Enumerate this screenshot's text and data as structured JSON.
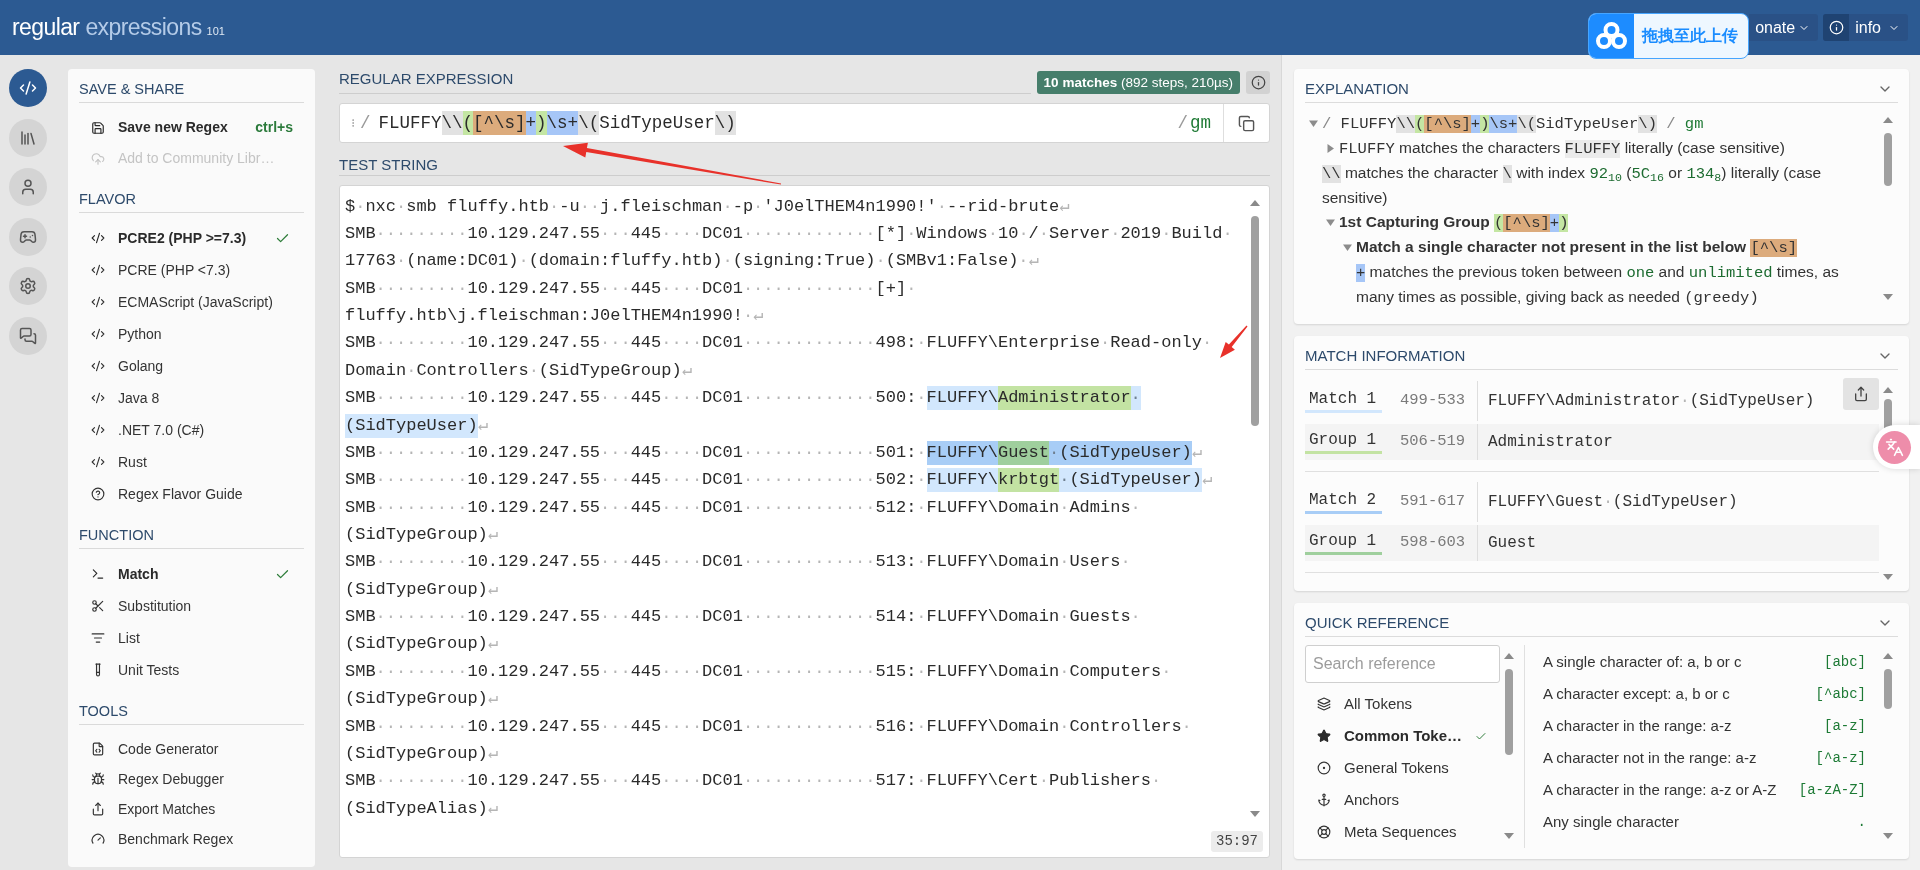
{
  "topbar": {
    "logo": {
      "primary": "regular",
      "secondary": "expressions",
      "version": "101"
    },
    "upload_widget": {
      "label": "拖拽至此上传"
    },
    "menus": [
      {
        "label": "onate"
      },
      {
        "label": "info"
      }
    ]
  },
  "rail": [
    {
      "selected": true
    },
    {
      "selected": false
    },
    {
      "selected": false
    },
    {
      "selected": false
    },
    {
      "selected": false
    },
    {
      "selected": false
    }
  ],
  "sidebar": {
    "sections": [
      {
        "kind": "actions",
        "title": "SAVE & SHARE",
        "items": [
          {
            "label": "Save new Regex",
            "shortcut": "ctrl+s",
            "disabled": false
          },
          {
            "label": "Add to Community Libr…",
            "disabled": true
          }
        ]
      },
      {
        "kind": "choices",
        "title": "FLAVOR",
        "items": [
          {
            "label": "PCRE2 (PHP >=7.3)",
            "selected": true
          },
          {
            "label": "PCRE (PHP <7.3)",
            "selected": false
          },
          {
            "label": "ECMAScript (JavaScript)",
            "selected": false
          },
          {
            "label": "Python",
            "selected": false
          },
          {
            "label": "Golang",
            "selected": false
          },
          {
            "label": "Java 8",
            "selected": false
          },
          {
            "label": ".NET 7.0 (C#)",
            "selected": false
          },
          {
            "label": "Rust",
            "selected": false
          },
          {
            "label": "Regex Flavor Guide",
            "selected": false
          }
        ]
      },
      {
        "kind": "choices",
        "title": "FUNCTION",
        "items": [
          {
            "label": "Match",
            "selected": true
          },
          {
            "label": "Substitution",
            "selected": false
          },
          {
            "label": "List",
            "selected": false
          },
          {
            "label": "Unit Tests",
            "selected": false
          }
        ]
      },
      {
        "kind": "links",
        "title": "TOOLS",
        "items": [
          {
            "label": "Code Generator"
          },
          {
            "label": "Regex Debugger"
          },
          {
            "label": "Export Matches"
          },
          {
            "label": "Benchmark Regex"
          }
        ]
      }
    ]
  },
  "regex": {
    "heading": "REGULAR EXPRESSION",
    "status": "**10 matches** (892 steps, 210µs)",
    "open_delimiter": "/",
    "tokens": [
      {
        "kind": "literal",
        "text": "FLUFFY"
      },
      {
        "kind": "escape",
        "text": "\\\\"
      },
      {
        "kind": "group",
        "text": "("
      },
      {
        "kind": "class",
        "text": "[^\\s]"
      },
      {
        "kind": "quantifier",
        "text": "+"
      },
      {
        "kind": "group",
        "text": ")"
      },
      {
        "kind": "meta",
        "text": "\\s+"
      },
      {
        "kind": "escape",
        "text": "\\("
      },
      {
        "kind": "literal",
        "text": "SidTypeUser"
      },
      {
        "kind": "escape",
        "text": "\\)"
      }
    ],
    "close_delimiter": "/",
    "flags": "gm"
  },
  "test_string": {
    "heading": "TEST STRING",
    "lines": [
      {
        "segments": [
          {
            "kind": "text",
            "text": "$·nxc·smb fluffy.htb·-u··j.fleischman·-p·'J0elTHEM4n1990!'·--rid-brute↵"
          }
        ]
      },
      {
        "segments": [
          {
            "kind": "text",
            "text": "SMB·········10.129.247.55···445····DC01·············[*]·Windows·10·/·Server·2019·Build·"
          }
        ]
      },
      {
        "segments": [
          {
            "kind": "text",
            "text": "17763·(name:DC01)·(domain:fluffy.htb)·(signing:True)·(SMBv1:False)·↵"
          }
        ]
      },
      {
        "segments": [
          {
            "kind": "text",
            "text": "SMB·········10.129.247.55···445····DC01·············[+]·"
          }
        ]
      },
      {
        "segments": [
          {
            "kind": "text",
            "text": "fluffy.htb\\j.fleischman:J0elTHEM4n1990!·↵"
          }
        ]
      },
      {
        "segments": [
          {
            "kind": "text",
            "text": "SMB·········10.129.247.55···445····DC01·············498:·FLUFFY\\Enterprise·Read-only·"
          }
        ]
      },
      {
        "segments": [
          {
            "kind": "text",
            "text": "Domain·Controllers·(SidTypeGroup)↵"
          }
        ]
      },
      {
        "segments": [
          {
            "kind": "text",
            "text": "SMB·········10.129.247.55···445····DC01·············500:·"
          },
          {
            "kind": "match",
            "text": "FLUFFY\\",
            "color": "#d2e7fd"
          },
          {
            "kind": "group",
            "text": "Administrator",
            "color": "#c3e3a3"
          },
          {
            "kind": "match",
            "text": "·",
            "color": "#d2e7fd"
          }
        ]
      },
      {
        "segments": [
          {
            "kind": "match",
            "text": "(SidTypeUser)",
            "color": "#d2e7fd"
          },
          {
            "kind": "text",
            "text": "↵"
          }
        ]
      },
      {
        "segments": [
          {
            "kind": "text",
            "text": "SMB·········10.129.247.55···445····DC01·············501:·"
          },
          {
            "kind": "match",
            "text": "FLUFFY\\",
            "color": "#a8cdf6"
          },
          {
            "kind": "group",
            "text": "Guest",
            "color": "#9fcf9d"
          },
          {
            "kind": "match",
            "text": "·(SidTypeUser)",
            "color": "#a8cdf6"
          },
          {
            "kind": "text",
            "text": "↵"
          }
        ]
      },
      {
        "segments": [
          {
            "kind": "text",
            "text": "SMB·········10.129.247.55···445····DC01·············502:·"
          },
          {
            "kind": "match",
            "text": "FLUFFY\\",
            "color": "#d2e7fd"
          },
          {
            "kind": "group",
            "text": "krbtgt",
            "color": "#c3e3a3"
          },
          {
            "kind": "match",
            "text": "·(SidTypeUser)",
            "color": "#d2e7fd"
          },
          {
            "kind": "text",
            "text": "↵"
          }
        ]
      },
      {
        "segments": [
          {
            "kind": "text",
            "text": "SMB·········10.129.247.55···445····DC01·············512:·FLUFFY\\Domain·Admins·"
          }
        ]
      },
      {
        "segments": [
          {
            "kind": "text",
            "text": "(SidTypeGroup)↵"
          }
        ]
      },
      {
        "segments": [
          {
            "kind": "text",
            "text": "SMB·········10.129.247.55···445····DC01·············513:·FLUFFY\\Domain·Users·"
          }
        ]
      },
      {
        "segments": [
          {
            "kind": "text",
            "text": "(SidTypeGroup)↵"
          }
        ]
      },
      {
        "segments": [
          {
            "kind": "text",
            "text": "SMB·········10.129.247.55···445····DC01·············514:·FLUFFY\\Domain·Guests·"
          }
        ]
      },
      {
        "segments": [
          {
            "kind": "text",
            "text": "(SidTypeGroup)↵"
          }
        ]
      },
      {
        "segments": [
          {
            "kind": "text",
            "text": "SMB·········10.129.247.55···445····DC01·············515:·FLUFFY\\Domain·Computers·"
          }
        ]
      },
      {
        "segments": [
          {
            "kind": "text",
            "text": "(SidTypeGroup)↵"
          }
        ]
      },
      {
        "segments": [
          {
            "kind": "text",
            "text": "SMB·········10.129.247.55···445····DC01·············516:·FLUFFY\\Domain·Controllers·"
          }
        ]
      },
      {
        "segments": [
          {
            "kind": "text",
            "text": "(SidTypeGroup)↵"
          }
        ]
      },
      {
        "segments": [
          {
            "kind": "text",
            "text": "SMB·········10.129.247.55···445····DC01·············517:·FLUFFY\\Cert·Publishers·"
          }
        ]
      },
      {
        "segments": [
          {
            "kind": "text",
            "text": "(SidTypeAlias)↵"
          }
        ]
      }
    ],
    "cursor": "35:97"
  },
  "explanation": {
    "title": "EXPLANATION",
    "tree": [
      {
        "kind": "node",
        "expanded": true,
        "parts": [
          {
            "kind": "delim",
            "text": "/ "
          },
          {
            "kind": "literal",
            "text": "FLUFFY"
          },
          {
            "kind": "escape",
            "text": "\\\\"
          },
          {
            "kind": "group",
            "text": "("
          },
          {
            "kind": "class",
            "text": "[^\\s]"
          },
          {
            "kind": "quantifier",
            "text": "+"
          },
          {
            "kind": "group",
            "text": ")"
          },
          {
            "kind": "meta",
            "text": "\\s+"
          },
          {
            "kind": "escape",
            "text": "\\("
          },
          {
            "kind": "literal",
            "text": "SidTypeUser"
          },
          {
            "kind": "escape",
            "text": "\\)"
          },
          {
            "kind": "delim",
            "text": " / "
          },
          {
            "kind": "flags",
            "text": "gm"
          }
        ],
        "children": [
          {
            "kind": "node",
            "expanded": false,
            "parts": [
              {
                "kind": "literal",
                "text": "FLUFFY"
              },
              {
                "kind": "text",
                "text": " matches the characters "
              },
              {
                "kind": "boxed",
                "text": "FLUFFY"
              },
              {
                "kind": "text",
                "text": " literally (case sensitive)"
              }
            ]
          },
          {
            "kind": "leaf",
            "parts": [
              {
                "kind": "escape",
                "text": "\\\\"
              },
              {
                "kind": "text",
                "text": " matches the character "
              },
              {
                "kind": "escape",
                "text": "\\"
              },
              {
                "kind": "text",
                "text": " with index "
              },
              {
                "kind": "number",
                "text": "92$_{10}$"
              },
              {
                "kind": "text",
                "text": " ("
              },
              {
                "kind": "number",
                "text": "5C$_{16}$"
              },
              {
                "kind": "text",
                "text": " or "
              },
              {
                "kind": "number",
                "text": "134$_{8}$"
              },
              {
                "kind": "text",
                "text": ") literally (case sensitive)"
              }
            ]
          },
          {
            "kind": "node",
            "expanded": true,
            "parts": [
              {
                "kind": "heading",
                "text": "1st Capturing Group "
              },
              {
                "kind": "group",
                "text": "("
              },
              {
                "kind": "class",
                "text": "[^\\s]"
              },
              {
                "kind": "quantifier",
                "text": "+"
              },
              {
                "kind": "group",
                "text": ")"
              }
            ],
            "children": [
              {
                "kind": "node",
                "expanded": true,
                "parts": [
                  {
                    "kind": "heading",
                    "text": "Match a single character not present in the list below "
                  },
                  {
                    "kind": "class",
                    "text": "[^\\s]"
                  }
                ],
                "children": [
                  {
                    "kind": "leaf",
                    "parts": [
                      {
                        "kind": "quantifier",
                        "text": "+"
                      },
                      {
                        "kind": "text",
                        "text": " matches the previous token between "
                      },
                      {
                        "kind": "number",
                        "text": "one"
                      },
                      {
                        "kind": "text",
                        "text": " and "
                      },
                      {
                        "kind": "number",
                        "text": "unlimited"
                      },
                      {
                        "kind": "text",
                        "text": " times, as many times as possible, giving back as needed "
                      },
                      {
                        "kind": "literal",
                        "text": "(greedy)"
                      }
                    ]
                  }
                ]
              }
            ]
          }
        ]
      }
    ]
  },
  "match_information": {
    "title": "MATCH INFORMATION",
    "matches": [
      {
        "rows": [
          {
            "kind": "match",
            "label": "Match 1",
            "range": "499-533",
            "value": "FLUFFY\\Administrator·(SidTypeUser)",
            "color": "#d2e7fd"
          },
          {
            "kind": "group",
            "label": "Group 1",
            "range": "506-519",
            "value": "Administrator",
            "color": "#c3e3a3"
          }
        ]
      },
      {
        "rows": [
          {
            "kind": "match",
            "label": "Match 2",
            "range": "591-617",
            "value": "FLUFFY\\Guest·(SidTypeUser)",
            "color": "#a8cdf6"
          },
          {
            "kind": "group",
            "label": "Group 1",
            "range": "598-603",
            "value": "Guest",
            "color": "#9fcf9d"
          }
        ]
      }
    ]
  },
  "quick_reference": {
    "title": "QUICK REFERENCE",
    "search": {
      "placeholder": "Search reference"
    },
    "categories": [
      {
        "label": "All Tokens",
        "selected": false
      },
      {
        "label": "Common Toke…",
        "selected": true
      },
      {
        "label": "General Tokens",
        "selected": false
      },
      {
        "label": "Anchors",
        "selected": false
      },
      {
        "label": "Meta Sequences",
        "selected": false
      }
    ],
    "entries": [
      {
        "description": "A single character of: a, b or c",
        "token": "[abc]"
      },
      {
        "description": "A character except: a, b or c",
        "token": "[^abc]"
      },
      {
        "description": "A character in the range: a-z",
        "token": "[a-z]"
      },
      {
        "description": "A character not in the range: a-z",
        "token": "[^a-z]"
      },
      {
        "description": "A character in the range: a-z or A-Z",
        "token": "[a-zA-Z]"
      },
      {
        "description": "Any single character",
        "token": "."
      }
    ]
  }
}
